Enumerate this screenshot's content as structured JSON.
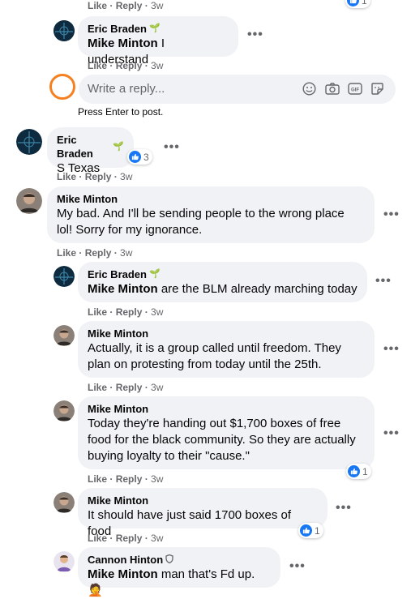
{
  "actions": {
    "like": "Like",
    "reply": "Reply",
    "sep": " · "
  },
  "reply_input": {
    "placeholder": "Write a reply...",
    "hint": "Press Enter to post."
  },
  "comments": [
    {
      "time": "3w"
    },
    {
      "author": "Eric Braden",
      "mention": "Mike Minton",
      "text": " I understand",
      "time": "3w"
    },
    {
      "author": "Eric Braden",
      "text": "S Texas",
      "time": "3w",
      "reaction_count": "3"
    },
    {
      "author": "Mike Minton",
      "text_lines": [
        "My bad. And I'll be sending people to the wrong place",
        "lol! Sorry for my ignorance."
      ],
      "time": "3w"
    },
    {
      "author": "Eric Braden",
      "mention": "Mike Minton",
      "text": " are the BLM already marching today",
      "time": "3w"
    },
    {
      "author": "Mike Minton",
      "text_lines": [
        "Actually, it is a group called until freedom. They",
        "plan on protesting from today until the 25th."
      ],
      "time": "3w"
    },
    {
      "author": "Mike Minton",
      "text_lines": [
        "Today they're handing out $1,700 boxes of free",
        "food for the black community. So they are actually",
        "buying loyalty to their \"cause.\""
      ],
      "time": "3w",
      "reaction_count": "1"
    },
    {
      "author": "Mike Minton",
      "text": "It should have just said 1700 boxes of food",
      "time": "3w",
      "reaction_count": "1"
    },
    {
      "author": "Cannon Hinton",
      "mention": "Mike Minton",
      "text": " man that's Fd up. ",
      "emoji": "🤦"
    }
  ],
  "top_reaction_count": "1",
  "colors": {
    "accent": "#1877f2",
    "bubble": "#f0f2f5",
    "meta": "#65676b",
    "orange_ring": "#f5801f"
  }
}
